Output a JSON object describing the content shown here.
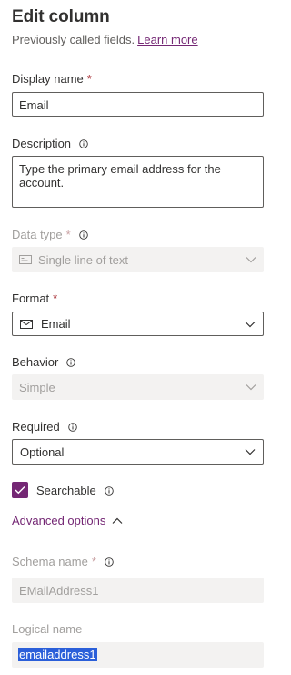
{
  "panel": {
    "title": "Edit column",
    "subtitle": "Previously called fields.",
    "learn_more": "Learn more"
  },
  "display_name": {
    "label": "Display name",
    "required": "*",
    "value": "Email"
  },
  "description": {
    "label": "Description",
    "value": "Type the primary email address for the account."
  },
  "data_type": {
    "label": "Data type",
    "required": "*",
    "value": "Single line of text",
    "icon": "text-line-icon"
  },
  "format": {
    "label": "Format",
    "required": "*",
    "value": "Email",
    "icon": "mail-icon"
  },
  "behavior": {
    "label": "Behavior",
    "value": "Simple"
  },
  "required_field": {
    "label": "Required",
    "value": "Optional"
  },
  "searchable": {
    "label": "Searchable",
    "checked": true
  },
  "advanced": {
    "label": "Advanced options"
  },
  "schema_name": {
    "label": "Schema name",
    "required": "*",
    "value": "EMailAddress1"
  },
  "logical_name": {
    "label": "Logical name",
    "value": "emailaddress1"
  },
  "colors": {
    "accent": "#742774",
    "required": "#a4262c",
    "selection": "#2b5fd9"
  }
}
